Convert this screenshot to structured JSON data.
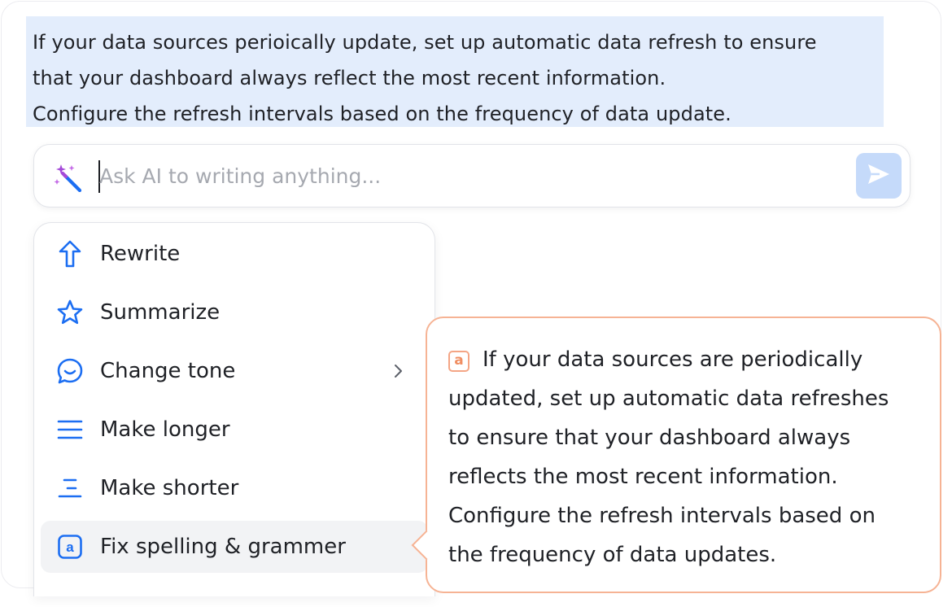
{
  "selection": {
    "lines": [
      "If your data sources perioically update, set up automatic data refresh to ensure",
      "that your dashboard always reflect the most recent information.",
      "Configure the refresh intervals based on the frequency of data update."
    ]
  },
  "ask_bar": {
    "icon": "magic-wand-icon",
    "placeholder": "Ask AI to writing anything...",
    "value": "",
    "send_icon": "send-icon"
  },
  "menu": {
    "items": [
      {
        "label": "Rewrite",
        "icon": "arrow-up-icon"
      },
      {
        "label": "Summarize",
        "icon": "star-icon"
      },
      {
        "label": "Change tone",
        "icon": "chat-bubble-icon",
        "has_submenu": true
      },
      {
        "label": "Make longer",
        "icon": "lines-icon"
      },
      {
        "label": "Make shorter",
        "icon": "short-lines-icon"
      },
      {
        "label": "Fix spelling & grammer",
        "icon": "spellcheck-icon",
        "active": true
      }
    ]
  },
  "suggestion": {
    "badge": "a",
    "lines": [
      "If your data sources are periodically",
      "updated, set up automatic data refreshes",
      "to ensure that your dashboard always",
      "reflects the most recent information.",
      "Configure the refresh intervals based on",
      "the frequency of data updates."
    ]
  },
  "colors": {
    "accent": "#1c6ef2",
    "selection_bg": "#e3edfc",
    "send_bg": "#c5dafa",
    "suggestion_border": "#f6b394",
    "magic_purple": "#a44ad8"
  }
}
